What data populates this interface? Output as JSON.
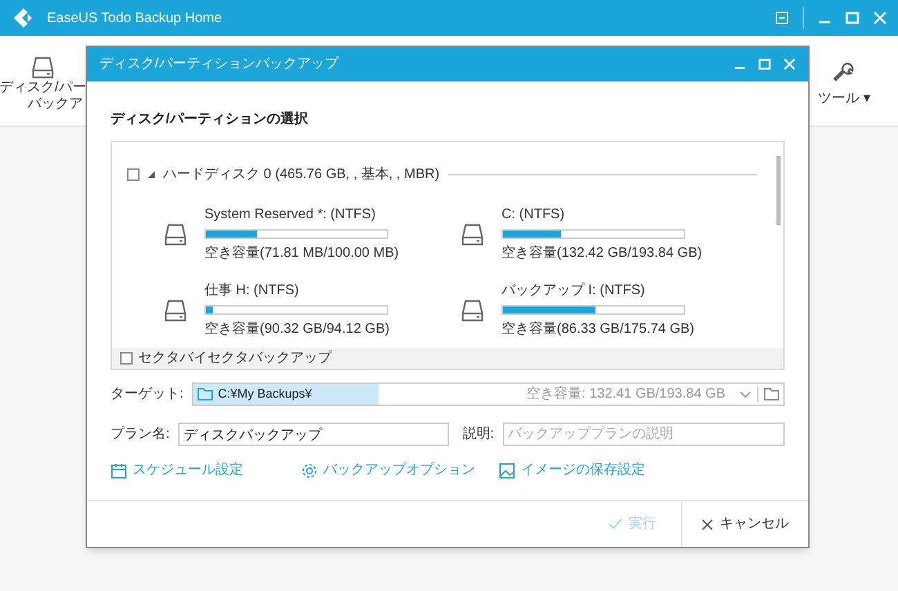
{
  "app": {
    "title": "EaseUS Todo Backup Home"
  },
  "toolbar": {
    "left_button": [
      "ディスク/パー",
      "バックア"
    ],
    "tools_button": {
      "label": "ツール",
      "caret": "▾"
    }
  },
  "dialog": {
    "title": "ディスク/パーティションバックアップ",
    "heading": "ディスク/パーティションの選択",
    "disk": {
      "label": "ハードディスク 0 (465.76 GB, , 基本, , MBR)",
      "checked": false,
      "expanded": true
    },
    "partitions": [
      {
        "name": "System Reserved *: (NTFS)",
        "level": 0.28,
        "free": "空き容量(71.81 MB/100.00 MB)"
      },
      {
        "name": "C: (NTFS)",
        "level": 0.32,
        "free": "空き容量(132.42 GB/193.84 GB)"
      },
      {
        "name": "仕事 H: (NTFS)",
        "level": 0.04,
        "free": "空き容量(90.32 GB/94.12 GB)"
      },
      {
        "name": "バックアップ I: (NTFS)",
        "level": 0.51,
        "free": "空き容量(86.33 GB/175.74 GB)"
      }
    ],
    "sector_by_sector": {
      "label": "セクタバイセクタバックアップ",
      "checked": false
    },
    "target": {
      "label": "ターゲット:",
      "value": "C:¥My Backups¥",
      "free": "空き容量: 132.41 GB/193.84 GB"
    },
    "plan_name": {
      "label": "プラン名:",
      "value": "ディスクバックアップ"
    },
    "description": {
      "label": "説明:",
      "placeholder": "バックアッププランの説明"
    },
    "links": [
      {
        "kind": "schedule",
        "label": "スケジュール設定"
      },
      {
        "kind": "options",
        "label": "バックアップオプション"
      },
      {
        "kind": "image",
        "label": "イメージの保存設定"
      }
    ],
    "run_button": {
      "label": "実行",
      "disabled": true
    },
    "cancel_button": {
      "label": "キャンセル"
    }
  }
}
